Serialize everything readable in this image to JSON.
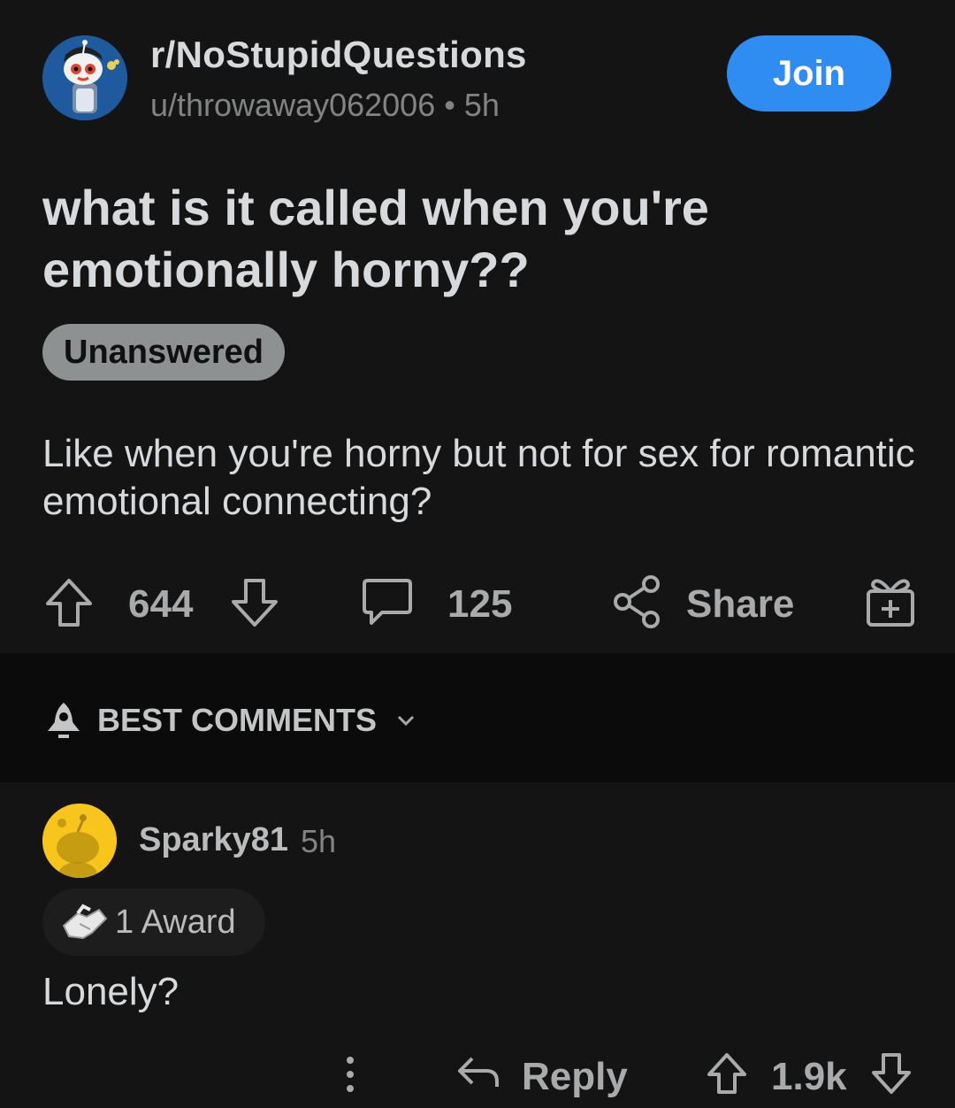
{
  "post": {
    "subreddit": "r/NoStupidQuestions",
    "author": "u/throwaway062006",
    "separator": "•",
    "age": "5h",
    "join_label": "Join",
    "title": "what is it called when you're emotionally horny??",
    "flair": "Unanswered",
    "body": "Like when you're horny but not for sex for romantic emotional connecting?",
    "upvotes": "644",
    "comments": "125",
    "share_label": "Share"
  },
  "sort": {
    "label": "BEST COMMENTS"
  },
  "comment": {
    "author": "Sparky81",
    "age": "5h",
    "award_label": "1 Award",
    "body": "Lonely?",
    "reply_label": "Reply",
    "score": "1.9k"
  },
  "colors": {
    "background": "#141414",
    "join_button": "#2f8cf0",
    "flair_background": "#8e9192",
    "subreddit_avatar": "#1f5a9e",
    "user_avatar": "#f7c51b"
  }
}
